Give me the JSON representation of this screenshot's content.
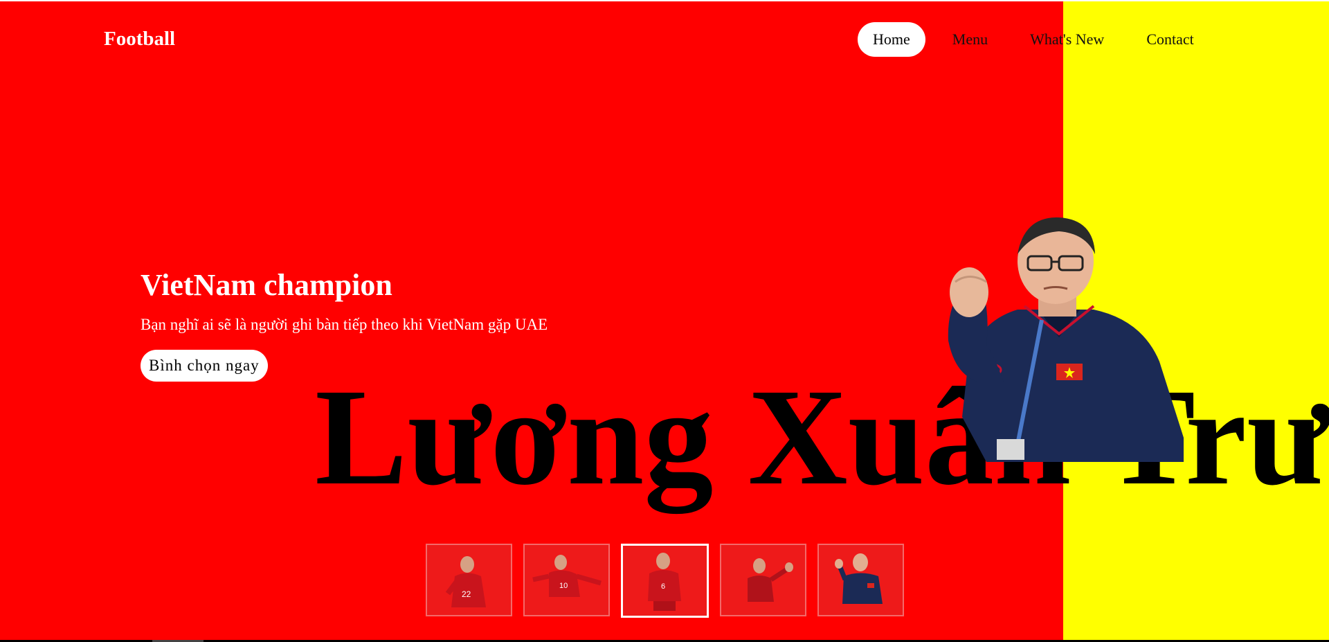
{
  "header": {
    "logo": "Football",
    "nav": [
      {
        "label": "Home",
        "active": true
      },
      {
        "label": "Menu",
        "active": false
      },
      {
        "label": "What's New",
        "active": false
      },
      {
        "label": "Contact",
        "active": false
      }
    ]
  },
  "hero": {
    "title": "VietNam champion",
    "subtitle": "Bạn nghĩ ai sẽ là người ghi bàn tiếp theo khi VietNam gặp UAE",
    "cta_label": "Bình chọn ngay",
    "big_name": "Lương Xuân Trườ"
  },
  "thumbnails": {
    "count": 5,
    "active_index": 2,
    "shirt_numbers": [
      "22",
      "10",
      "6",
      "",
      ""
    ]
  },
  "colors": {
    "primary_bg": "#ff0000",
    "accent_panel": "#ffff00",
    "text_light": "#ffffff",
    "text_dark": "#000000"
  }
}
